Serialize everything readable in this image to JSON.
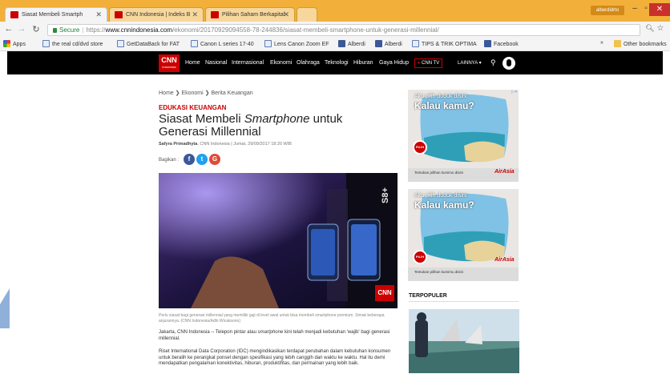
{
  "browser": {
    "tabs": [
      {
        "label": "Siasat Membeli Smartph"
      },
      {
        "label": "CNN Indonesia | Indeks B"
      },
      {
        "label": "Pilihan Saham Berkapital"
      }
    ],
    "user": "alberdidrto",
    "url": {
      "secure_label": "Secure",
      "scheme": "https://",
      "host": "www.cnnindonesia.com",
      "path": "/ekonomi/20170929094558-78-244836/siasat-membeli-smartphone-untuk-generasi-millennial/"
    },
    "bookmarks": [
      {
        "label": "Apps",
        "icon": "apps-grid-icon"
      },
      {
        "label": "the real cd/dvd store",
        "icon": "bookmark-page-icon"
      },
      {
        "label": "GetDataBack for FAT",
        "icon": "bookmark-page-icon"
      },
      {
        "label": "Canon L series 17-40",
        "icon": "bookmark-page-icon"
      },
      {
        "label": "Lens Canon Zoom EF",
        "icon": "bookmark-page-icon"
      },
      {
        "label": "Alberdi",
        "icon": "facebook-icon"
      },
      {
        "label": "Alberdi",
        "icon": "facebook-icon"
      },
      {
        "label": "TIPS & TRIK OPTIMA",
        "icon": "bookmark-page-icon"
      },
      {
        "label": "Facebook",
        "icon": "facebook-icon"
      }
    ],
    "more_bookmarks_label": "»",
    "other_bookmarks_label": "Other bookmarks",
    "colors": {
      "chrome_accent": "#f2b03a",
      "tab_active": "#f4f4f4"
    }
  },
  "site": {
    "logo_main": "CNN",
    "logo_sub": "Indonesia",
    "nav": [
      "Home",
      "Nasional",
      "Internasional",
      "Ekonomi",
      "Olahraga",
      "Teknologi",
      "Hiburan",
      "Gaya Hidup"
    ],
    "cnn_tv_label": "CNN TV",
    "more_label": "LAINNYA ▾",
    "brand_color": "#cc0000"
  },
  "article": {
    "breadcrumb": [
      "Home",
      "Ekonomi",
      "Berita Keuangan"
    ],
    "kicker": "EDUKASI KEUANGAN",
    "title_pre": "Siasat Membeli ",
    "title_em": "Smartphone",
    "title_post": " untuk Generasi Millennial",
    "author": "Safyra Primadhyta",
    "source_date": ", CNN Indonesia | Jumat, 29/09/2017 18:20 WIB",
    "share_label": "Bagikan :",
    "caption": "Perlu siasat bagi generasi millennial yang memiliki gaji di level awal untuk bisa membeli smartphone premium. Simak beberapa anjurannya. (CNN Indonesia/Adhi Wicaksono)",
    "p1_pre": "Jakarta, CNN Indonesia -- Telepon pintar atau ",
    "p1_em": "smartphone",
    "p1_post": " kini telah menjadi kebutuhan 'wajib' bagi generasi millennial.",
    "p2": "Riset International Data Corporation (IDC) mengindikasikan terdapat perubahan dalam kebutuhan konsumen untuk beralih ke perangkat ponsel dengan spesifikasi yang lebih canggih dari waktu ke waktu. Hal itu demi mendapatkan pengalaman konektivitas, hiburan, produktifitas, dan permainan yang lebih baik.",
    "photo_watermark": "CNN",
    "phone_badge": "S8+"
  },
  "sidebar": {
    "ad_headline_1": "Aku pilih duduk disini.",
    "ad_headline_2": "Kalau kamu?",
    "ad_cta": "Tentukan pilihan kursimu disini",
    "ad_brand": "AirAsia",
    "ad_badge": "PILIH",
    "popular_heading": "TERPOPULER"
  }
}
